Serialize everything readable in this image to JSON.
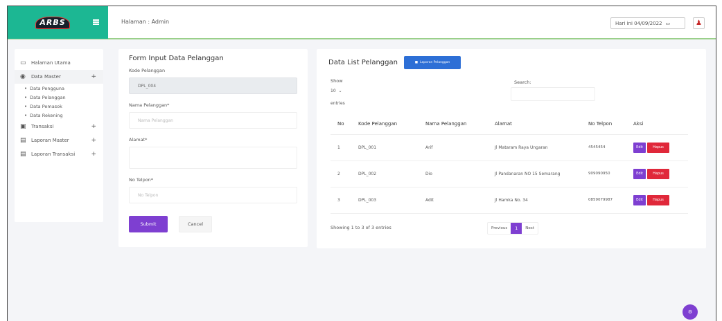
{
  "brand": {
    "logo": "ARBS",
    "color": "#1cb793"
  },
  "header": {
    "title": "Halaman : Admin",
    "date": "Hari ini 04/09/2022",
    "calendar_icon": "calendar-icon",
    "user_icon": "user-icon"
  },
  "sidebar": {
    "items": [
      {
        "label": "Halaman Utama",
        "icon": "monitor-icon"
      },
      {
        "label": "Data Master",
        "icon": "database-icon",
        "toggle": "+"
      },
      {
        "label": "Transaksi",
        "icon": "cart-icon",
        "toggle": "+"
      },
      {
        "label": "Laporan Master",
        "icon": "report-icon",
        "toggle": "+"
      },
      {
        "label": "Laporan Transaksi",
        "icon": "report-icon",
        "toggle": "+"
      }
    ],
    "subitems": [
      "Data Pengguna",
      "Data Pelanggan",
      "Data Pemasok",
      "Data Rekening"
    ]
  },
  "form": {
    "title": "Form Input Data Pelanggan",
    "kode_label": "Kode Pelanggan",
    "kode_value": "DPL_004",
    "nama_label": "Nama Pelanggan*",
    "nama_placeholder": "Nama Pelanggan",
    "alamat_label": "Alamat*",
    "alamat_placeholder": "",
    "telp_label": "No Telpon*",
    "telp_placeholder": "No Telpon",
    "submit": "Submit",
    "cancel": "Cancel"
  },
  "list": {
    "title": "Data List Pelanggan",
    "laporan_btn": "Laporan Pelanggan",
    "show": "Show",
    "show_value": "10",
    "entries": "entries",
    "search": "Search:",
    "columns": [
      "No",
      "Kode Pelanggan",
      "Nama Pelanggan",
      "Alamat",
      "No Telpon",
      "Aksi"
    ],
    "rows": [
      {
        "no": "1",
        "kode": "DPL_001",
        "nama": "Arif",
        "alamat": "Jl Mataram Raya Ungaran",
        "telp": "4545454"
      },
      {
        "no": "2",
        "kode": "DPL_002",
        "nama": "Dio",
        "alamat": "Jl Pandanaran NO 15 Semarang",
        "telp": "909090950"
      },
      {
        "no": "3",
        "kode": "DPL_003",
        "nama": "Adit",
        "alamat": "Jl Hamka No. 34",
        "telp": "0859079987"
      }
    ],
    "edit": "Edit",
    "hapus": "Hapus",
    "info": "Showing 1 to 3 of 3 entries",
    "prev": "Previous",
    "page": "1",
    "next": "Next"
  },
  "colors": {
    "accent": "#7e3fd1",
    "danger": "#e0283a",
    "primary": "#2d6fd6"
  }
}
